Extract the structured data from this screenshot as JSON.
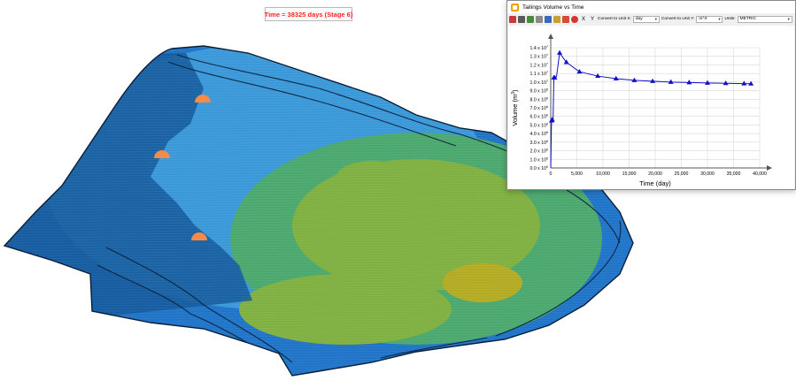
{
  "scene": {
    "time_banner": "Time  = 38325 days (Stage 6)",
    "colors": {
      "deep_water": "#14589a",
      "water": "#1f74c8",
      "shallow": "#3a98d8",
      "mid": "#4aa86e",
      "high": "#7fb040",
      "peak": "#b3ab22",
      "outline": "#0a1e38",
      "marker": "#f58a4a"
    },
    "markers": [
      "discharge-point",
      "discharge-point",
      "discharge-point"
    ]
  },
  "window": {
    "title": "Tailings Volume vs Time",
    "toolbar": {
      "icons": [
        "chart-icon",
        "print-icon",
        "image-icon",
        "copy-icon",
        "table-icon",
        "settings-icon",
        "export-icon",
        "stop-icon"
      ],
      "x_button": "X",
      "y_button": "Y",
      "convert_x_label": "Convert to Unit X:",
      "convert_x_value": "day",
      "convert_y_label": "Convert to Unit Y:",
      "convert_y_value": "m^3",
      "units_label": "Units:",
      "units_value": "METRIC"
    }
  },
  "chart_data": {
    "type": "line",
    "title": "",
    "xlabel": "Time (day)",
    "ylabel": "Volume (m^3)",
    "xlim": [
      0,
      40000
    ],
    "ylim": [
      0,
      14000000
    ],
    "x_ticks": [
      "0",
      "5,000",
      "10,000",
      "15,000",
      "20,000",
      "25,000",
      "30,000",
      "35,000",
      "40,000"
    ],
    "y_ticks": [
      "0.0 x 10^0",
      "1.0 x 10^6",
      "2.0 x 10^6",
      "3.0 x 10^6",
      "4.0 x 10^6",
      "5.0 x 10^6",
      "6.0 x 10^6",
      "7.0 x 10^6",
      "8.0 x 10^6",
      "9.0 x 10^6",
      "1.0 x 10^7",
      "1.1 x 10^7",
      "1.2 x 10^7",
      "1.3 x 10^7",
      "1.4 x 10^7"
    ],
    "grid": true,
    "marker": "triangle",
    "color": "#1010c8",
    "series": [
      {
        "name": "",
        "x": [
          0,
          150,
          300,
          450,
          600,
          750,
          900,
          1100,
          1700,
          3000,
          5500,
          9000,
          12500,
          16000,
          19500,
          23000,
          26500,
          30000,
          33500,
          37000,
          38325
        ],
        "y": [
          0,
          5500000,
          5600000,
          5600000,
          10500000,
          10500000,
          10600000,
          10600000,
          13400000,
          12300000,
          11200000,
          10700000,
          10400000,
          10200000,
          10100000,
          10000000,
          9950000,
          9900000,
          9850000,
          9820000,
          9800000
        ],
        "markers": [
          false,
          true,
          true,
          false,
          true,
          true,
          false,
          false,
          true,
          true,
          true,
          true,
          true,
          true,
          true,
          true,
          true,
          true,
          true,
          true,
          true
        ]
      }
    ]
  }
}
